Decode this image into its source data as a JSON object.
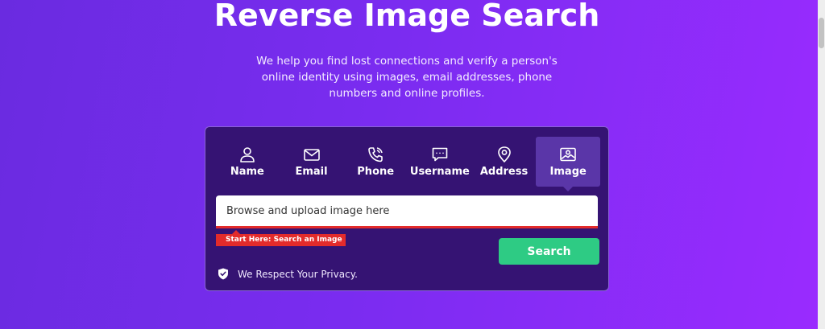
{
  "hero": {
    "title": "Reverse Image Search",
    "subtitle": "We help you find lost connections and verify a person's online identity using images, email addresses, phone numbers and online profiles."
  },
  "tabs": [
    {
      "label": "Name",
      "icon": "user-icon"
    },
    {
      "label": "Email",
      "icon": "envelope-icon"
    },
    {
      "label": "Phone",
      "icon": "phone-icon"
    },
    {
      "label": "Username",
      "icon": "chat-bubble-icon"
    },
    {
      "label": "Address",
      "icon": "map-pin-icon"
    },
    {
      "label": "Image",
      "icon": "image-icon",
      "active": true
    }
  ],
  "search": {
    "placeholder": "Browse and upload image here",
    "hint": "Start Here: Search an Image",
    "button_label": "Search"
  },
  "privacy": {
    "text": "We Respect Your Privacy.",
    "icon": "shield-check-icon"
  },
  "colors": {
    "background_start": "#6a2be0",
    "background_end": "#9a2bff",
    "card": "#351373",
    "active_tab": "#5a36a8",
    "search_button": "#2ecb84",
    "hint_red": "#e32b2b"
  }
}
